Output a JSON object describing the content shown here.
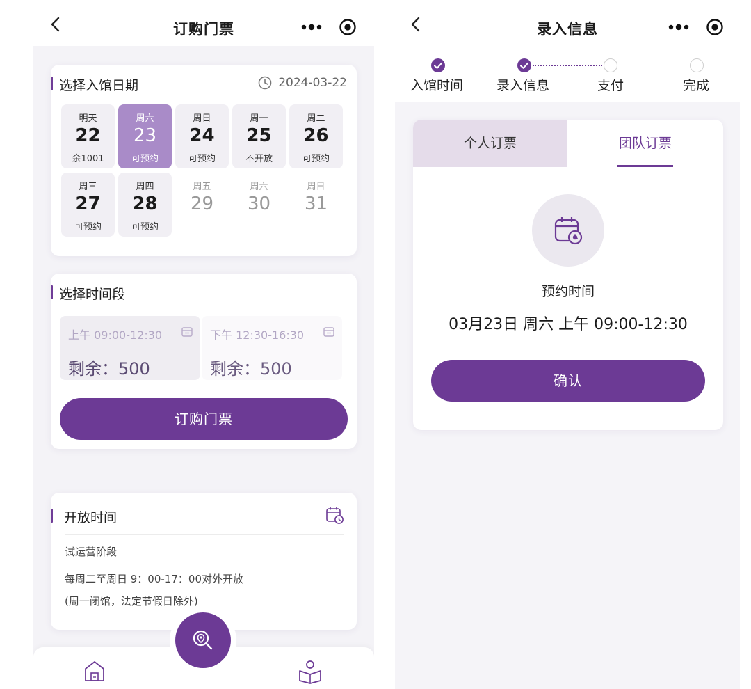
{
  "left_screen": {
    "nav_title": "订购门票",
    "date_section": {
      "title": "选择入馆日期",
      "current_date": "2024-03-22",
      "dates": [
        {
          "week": "明天",
          "day": "22",
          "status": "余1001"
        },
        {
          "week": "周六",
          "day": "23",
          "status": "可预约"
        },
        {
          "week": "周日",
          "day": "24",
          "status": "可预约"
        },
        {
          "week": "周一",
          "day": "25",
          "status": "不开放"
        },
        {
          "week": "周二",
          "day": "26",
          "status": "可预约"
        },
        {
          "week": "周三",
          "day": "27",
          "status": "可预约"
        },
        {
          "week": "周四",
          "day": "28",
          "status": "可预约"
        },
        {
          "week": "周五",
          "day": "29",
          "status": ""
        },
        {
          "week": "周六",
          "day": "30",
          "status": ""
        },
        {
          "week": "周日",
          "day": "31",
          "status": ""
        }
      ]
    },
    "time_section": {
      "title": "选择时间段",
      "slots": [
        {
          "time": "上午 09:00-12:30",
          "remaining": "剩余：500"
        },
        {
          "time": "下午 12:30-16:30",
          "remaining": "剩余：500"
        }
      ],
      "button_label": "订购门票"
    },
    "open_section": {
      "title": "开放时间",
      "lines": [
        "试运营阶段",
        "每周二至周日 9：00-17：00对外开放",
        "(周一闭馆，法定节假日除外)"
      ]
    }
  },
  "right_screen": {
    "nav_title": "录入信息",
    "steps": [
      {
        "label": "入馆时间",
        "done": true
      },
      {
        "label": "录入信息",
        "done": true
      },
      {
        "label": "支付",
        "done": false
      },
      {
        "label": "完成",
        "done": false
      }
    ],
    "tabs": {
      "individual": "个人订票",
      "group": "团队订票"
    },
    "reserve_label": "预约时间",
    "reserve_value": "03月23日 周六 上午 09:00-12:30",
    "confirm_label": "确认"
  },
  "colors": {
    "brand_purple": "#6c3a95",
    "selected_date": "#a98bc8",
    "tab_inactive": "#e5dcea"
  },
  "icons": {
    "nav_back": "chevron-left-icon",
    "more": "more-dots-icon",
    "close": "target-circle-icon",
    "clock": "clock-icon",
    "calendar": "calendar-icon",
    "location_search": "location-search-icon",
    "home": "home-icon",
    "reader": "reader-book-icon",
    "check": "check-icon"
  }
}
